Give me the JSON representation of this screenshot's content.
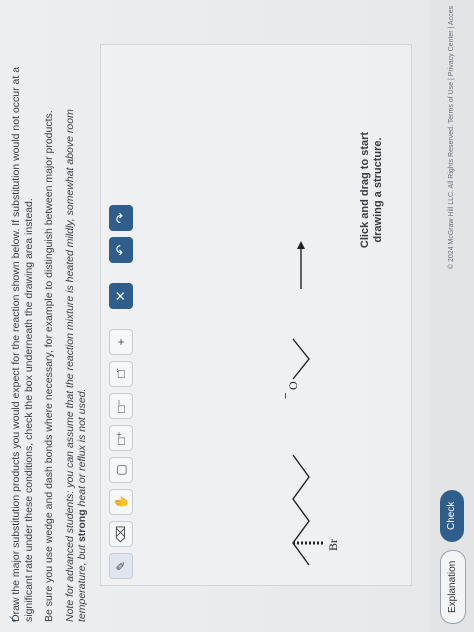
{
  "question": {
    "check_mark": "✓",
    "paragraph1": "Draw the major substitution products you would expect for the reaction shown below. If substitution would not occur at a significant rate under these conditions, check the box underneath the drawing area instead.",
    "paragraph2": "Be sure you use wedge and dash bonds where necessary, for example to distinguish between major products.",
    "paragraph3_prefix": "Note for advanced students: you can assume that the reaction mixture is heated mildly, somewhat above room temperature, but ",
    "paragraph3_bold": "strong",
    "paragraph3_suffix": " heat or reflux is not used."
  },
  "toolbar": {
    "tools": [
      {
        "name": "pencil-icon",
        "glyph": "✎"
      },
      {
        "name": "eraser-icon",
        "glyph": "⌫"
      },
      {
        "name": "hand-icon",
        "glyph": "✋"
      },
      {
        "name": "ring-icon",
        "glyph": "▢"
      },
      {
        "name": "charge-plus-icon",
        "glyph": "□⁺"
      },
      {
        "name": "charge-minus-icon",
        "glyph": "□⁻"
      },
      {
        "name": "lone-pair-icon",
        "glyph": "□̈"
      },
      {
        "name": "add-icon",
        "glyph": "+"
      }
    ],
    "clear_glyph": "✕",
    "undo_glyph": "↶",
    "redo_glyph": "↷"
  },
  "reaction": {
    "substrate_label": "Br",
    "reagent_label": "O",
    "reagent_charge": "−"
  },
  "drawing_hint_line1": "Click and drag to start",
  "drawing_hint_line2": "drawing a structure.",
  "buttons": {
    "explanation": "Explanation",
    "check": "Check"
  },
  "footer": "© 2024 McGraw Hill LLC. All Rights Reserved.   Terms of Use  |  Privacy Center  |  Acces"
}
